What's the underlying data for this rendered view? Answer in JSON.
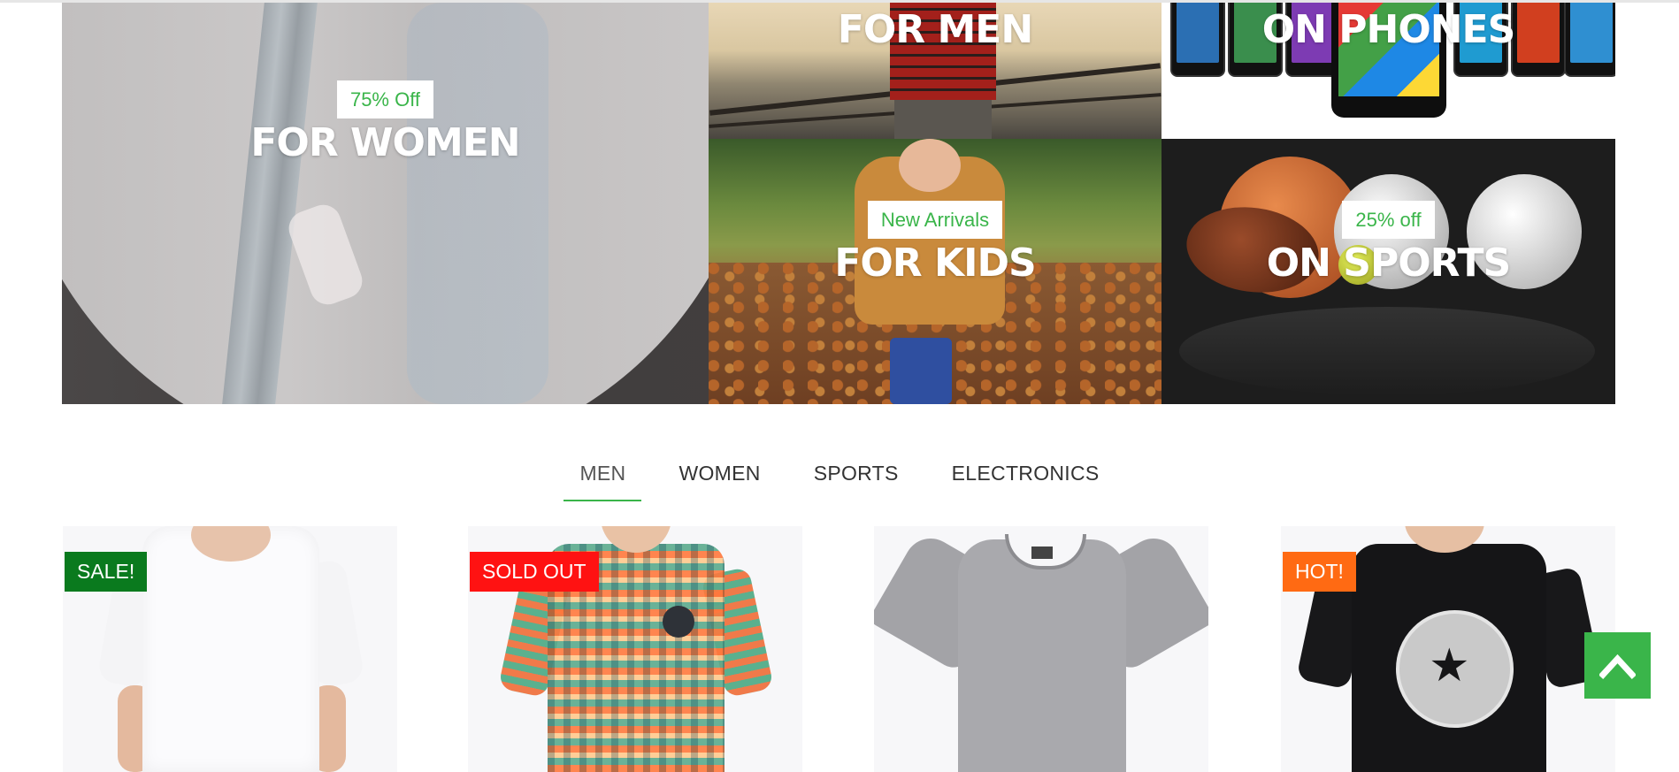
{
  "banners": {
    "women": {
      "badge": "75% Off",
      "title": "FOR WOMEN"
    },
    "men": {
      "title": "FOR MEN"
    },
    "phones": {
      "title": "ON PHONES"
    },
    "kids": {
      "badge": "New Arrivals",
      "title": "FOR KIDS"
    },
    "sports": {
      "badge": "25% off",
      "title": "ON SPORTS"
    }
  },
  "tabs": [
    {
      "label": "MEN",
      "active": true
    },
    {
      "label": "WOMEN",
      "active": false
    },
    {
      "label": "SPORTS",
      "active": false
    },
    {
      "label": "ELECTRONICS",
      "active": false
    }
  ],
  "products": [
    {
      "tag": "SALE!",
      "tag_color": "#0a7a1e"
    },
    {
      "tag": "SOLD OUT",
      "tag_color": "#ff1212"
    },
    {
      "tag": null
    },
    {
      "tag": "HOT!",
      "tag_color": "#ff6a13"
    }
  ],
  "back_to_top": {
    "icon": "chevron-up-icon"
  },
  "colors": {
    "accent": "#3ab54a",
    "sale": "#0a7a1e",
    "sold_out": "#ff1212",
    "hot": "#ff6a13"
  }
}
